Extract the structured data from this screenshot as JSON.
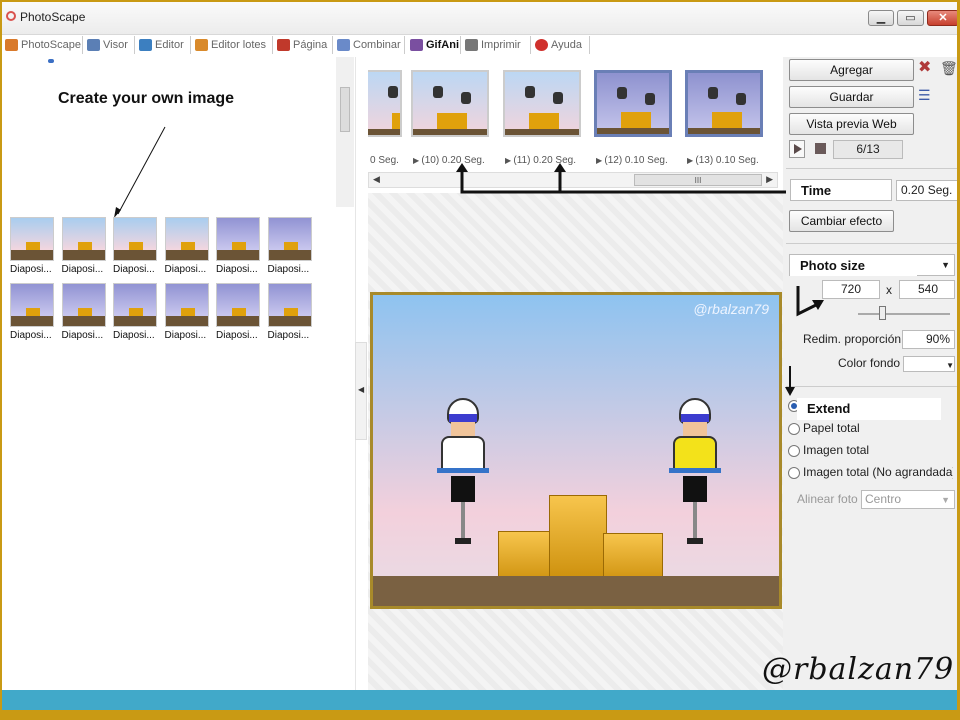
{
  "window": {
    "title": "PhotoScape",
    "min_glyph": "▁",
    "max_glyph": "▭",
    "close_glyph": "✕"
  },
  "menu": [
    {
      "label": "PhotoScape",
      "icon": "photoscape-icon",
      "color": "#d97a2b"
    },
    {
      "label": "Visor",
      "icon": "viewer-icon",
      "color": "#5b7fb5"
    },
    {
      "label": "Editor",
      "icon": "editor-icon",
      "color": "#3c7fc0"
    },
    {
      "label": "Editor lotes",
      "icon": "batch-editor-icon",
      "color": "#d98a2b"
    },
    {
      "label": "Página",
      "icon": "page-icon",
      "color": "#c0392b"
    },
    {
      "label": "Combinar",
      "icon": "combine-icon",
      "color": "#6a8ac9"
    },
    {
      "label": "GifAni",
      "icon": "gifani-icon",
      "color": "#7a4fa0"
    },
    {
      "label": "Imprimir",
      "icon": "print-icon",
      "color": "#777777"
    },
    {
      "label": "Ayuda",
      "icon": "help-icon",
      "color": "#d0312d"
    }
  ],
  "annotations": {
    "create": "Create your own image",
    "time": "Time",
    "photo_size": "Photo size",
    "extend": "Extend",
    "handle": "@rbalzan79"
  },
  "thumbnails": [
    {
      "label": "Diaposi...",
      "tint": "light"
    },
    {
      "label": "Diaposi...",
      "tint": "light"
    },
    {
      "label": "Diaposi...",
      "tint": "light"
    },
    {
      "label": "Diaposi...",
      "tint": "light"
    },
    {
      "label": "Diaposi...",
      "tint": "purple"
    },
    {
      "label": "Diaposi...",
      "tint": "purple"
    },
    {
      "label": "Diaposi...",
      "tint": "purple"
    },
    {
      "label": "Diaposi...",
      "tint": "purple"
    },
    {
      "label": "Diaposi...",
      "tint": "purple"
    },
    {
      "label": "Diaposi...",
      "tint": "purple"
    },
    {
      "label": "Diaposi...",
      "tint": "purple"
    },
    {
      "label": "Diaposi...",
      "tint": "purple"
    }
  ],
  "filmstrip": {
    "frames": [
      {
        "label": "0 Seg.",
        "selected": false
      },
      {
        "label": "(10) 0.20 Seg.",
        "selected": false
      },
      {
        "label": "(11) 0.20 Seg.",
        "selected": false
      },
      {
        "label": "(12) 0.10 Seg.",
        "selected": true
      },
      {
        "label": "(13) 0.10 Seg.",
        "selected": true
      }
    ],
    "scroll_glyph": "III"
  },
  "preview": {
    "watermark": "@rbalzan79"
  },
  "panel": {
    "add": "Agregar",
    "save": "Guardar",
    "web_preview": "Vista previa Web",
    "counter": "6/13",
    "time_value": "0.20 Seg.",
    "change_effect": "Cambiar efecto",
    "width": "720",
    "x": "x",
    "height": "540",
    "resize_label": "Redim. proporción",
    "resize_value": "90%",
    "bg_color_label": "Color fondo",
    "options": [
      {
        "label": "Papel total",
        "checked": false
      },
      {
        "label": "Imagen total",
        "checked": false
      },
      {
        "label": "Imagen total (No agrandada)",
        "checked": false
      }
    ],
    "align_label": "Alinear foto",
    "align_value": "Centro"
  }
}
